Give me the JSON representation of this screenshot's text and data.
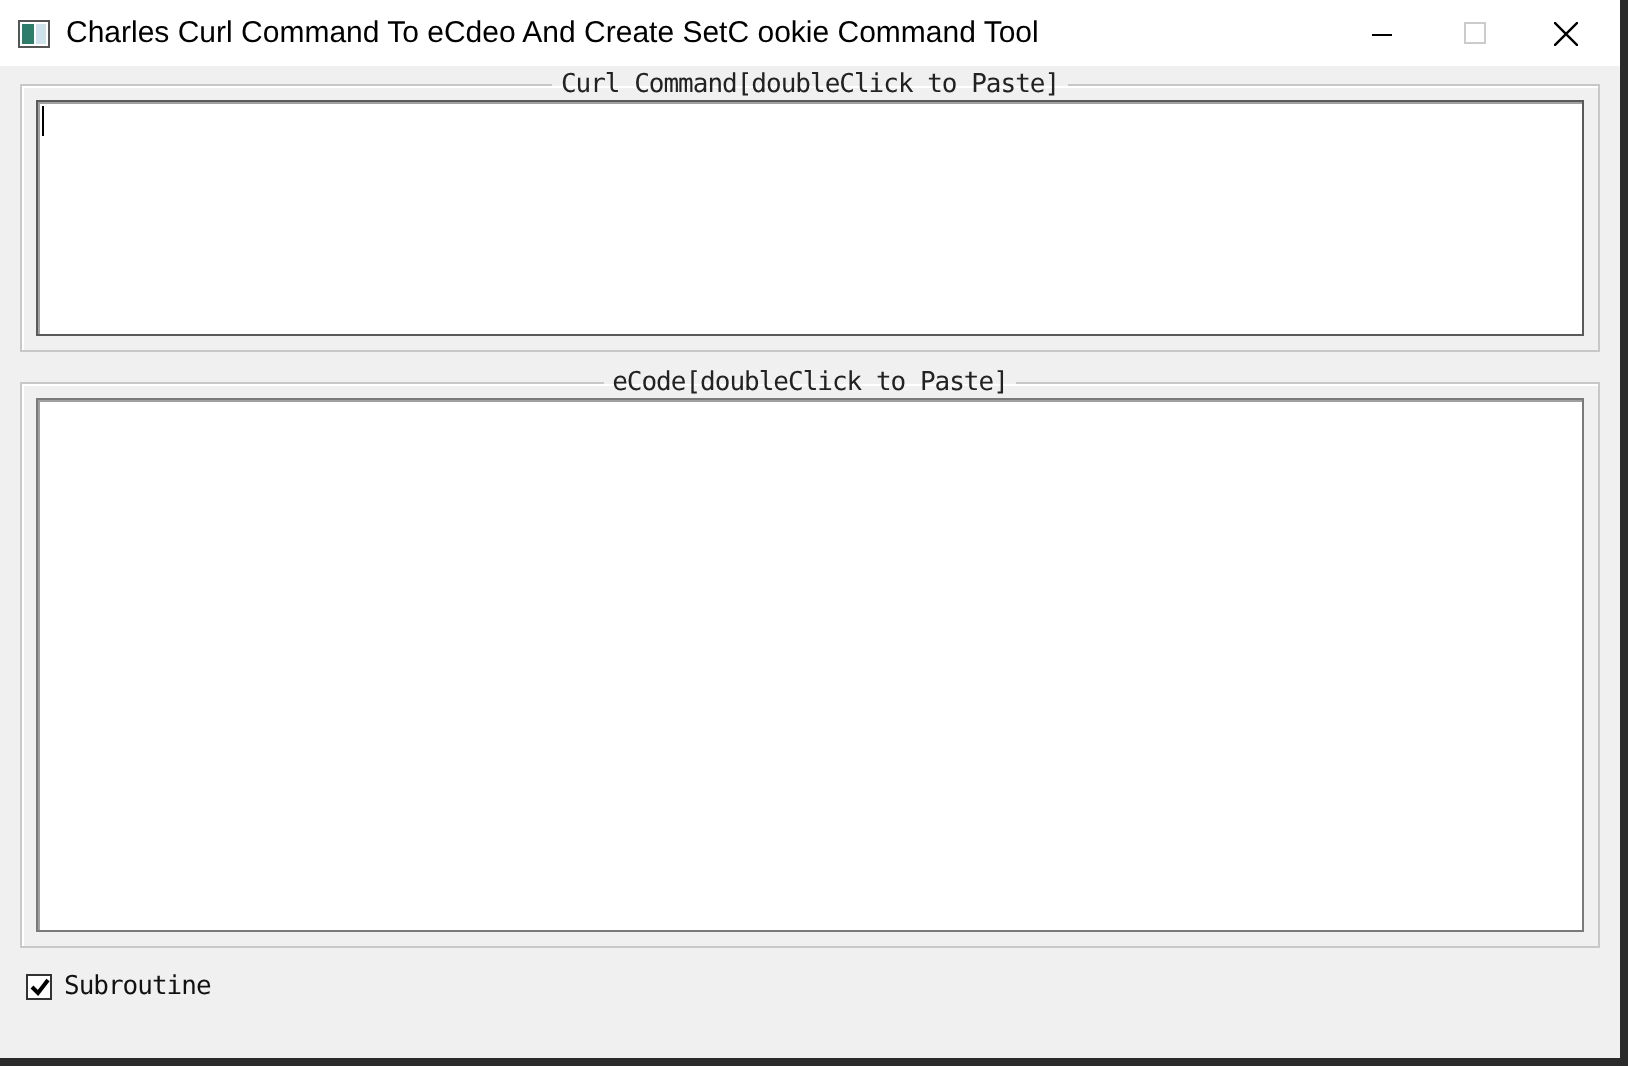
{
  "window": {
    "title": "Charles Curl Command To eCdeo And Create SetC ookie Command Tool"
  },
  "groups": [
    {
      "label": "Curl Command[doubleClick to Paste]",
      "focused": true
    },
    {
      "label": "eCode[doubleClick to Paste]",
      "focused": false
    }
  ],
  "subroutine": {
    "label": "Subroutine",
    "checked": true
  }
}
